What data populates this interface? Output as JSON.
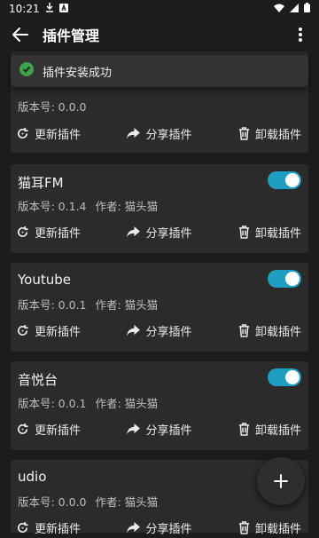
{
  "status": {
    "time": "10:21"
  },
  "appbar": {
    "title": "插件管理"
  },
  "toast": {
    "message": "插件安装成功"
  },
  "actions": {
    "update": "更新插件",
    "share": "分享插件",
    "uninstall": "卸载插件"
  },
  "plugins": [
    {
      "version": "版本号: 0.0.0"
    },
    {
      "name": "猫耳FM",
      "version": "版本号: 0.1.4",
      "author": "作者: 猫头猫",
      "enabled": true
    },
    {
      "name": "Youtube",
      "version": "版本号: 0.0.1",
      "author": "作者: 猫头猫",
      "enabled": true
    },
    {
      "name": "音悦台",
      "version": "版本号: 0.0.1",
      "author": "作者: 猫头猫",
      "enabled": true
    },
    {
      "name": "udio",
      "version": "版本号: 0.0.0",
      "author": "作者: 猫头猫"
    }
  ],
  "colors": {
    "toggle_on": "#1f9ec1",
    "success": "#3ea34a"
  }
}
